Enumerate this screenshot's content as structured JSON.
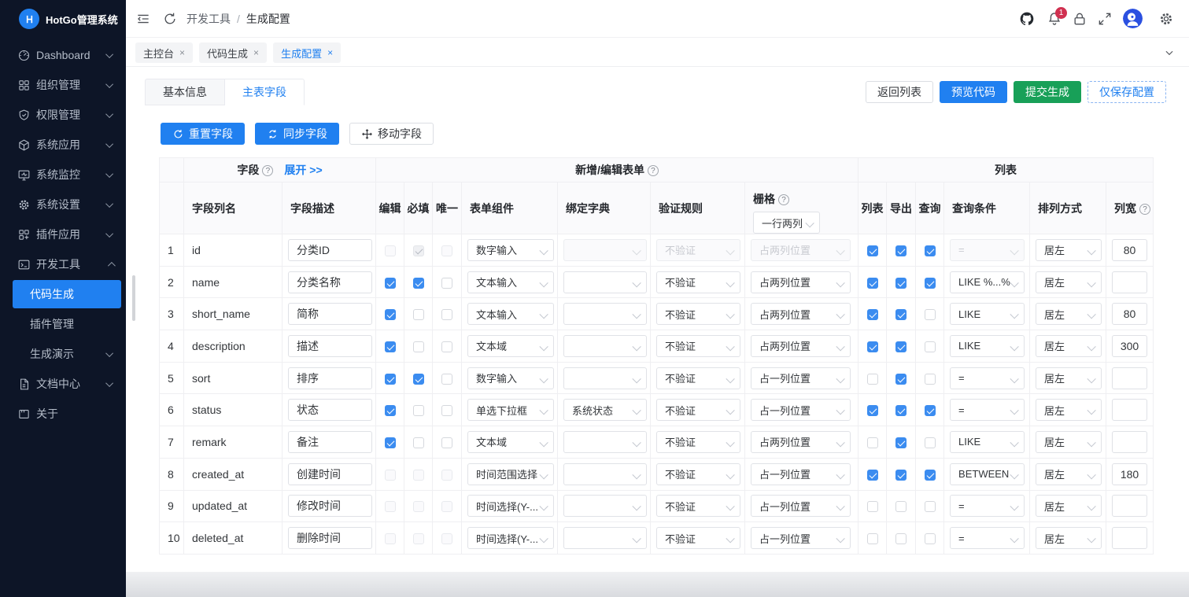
{
  "app": {
    "title": "HotGo管理系统"
  },
  "topbar": {
    "breadcrumb": [
      "开发工具",
      "生成配置"
    ],
    "separator": "/",
    "notification_count": "1"
  },
  "nav_tabs": [
    {
      "label": "主控台",
      "close": "×"
    },
    {
      "label": "代码生成",
      "close": "×"
    },
    {
      "label": "生成配置",
      "close": "×",
      "active": true
    }
  ],
  "page_tabs": [
    {
      "label": "基本信息"
    },
    {
      "label": "主表字段",
      "active": true
    }
  ],
  "header_buttons": [
    {
      "label": "返回列表",
      "variant": "default"
    },
    {
      "label": "预览代码",
      "variant": "primary"
    },
    {
      "label": "提交生成",
      "variant": "success"
    },
    {
      "label": "仅保存配置",
      "variant": "dashed"
    }
  ],
  "action_buttons": [
    {
      "label": "重置字段",
      "variant": "primary",
      "icon": "reset"
    },
    {
      "label": "同步字段",
      "variant": "primary",
      "icon": "sync"
    },
    {
      "label": "移动字段",
      "variant": "default",
      "icon": "move"
    }
  ],
  "table": {
    "groups": {
      "field": "字段",
      "form": "新增/编辑表单",
      "list": "列表"
    },
    "expand_link": "展开 >>",
    "columns": [
      "字段列名",
      "字段描述",
      "编辑",
      "必填",
      "唯一",
      "表单组件",
      "绑定字典",
      "验证规则",
      "栅格",
      "列表",
      "导出",
      "查询",
      "查询条件",
      "排列方式",
      "列宽"
    ],
    "grid_header_select": "一行两列",
    "rows": [
      {
        "idx": "1",
        "col": "id",
        "desc": "分类ID",
        "edit": "dis-off",
        "req": "dis-on",
        "uniq": "dis-off",
        "widget": "数字输入",
        "dict": "",
        "rule": "不验证",
        "grid": "占两列位置",
        "dis": true,
        "list": "on",
        "exp": "on",
        "qry": "on",
        "cond": "=",
        "align": "居左",
        "width": "80"
      },
      {
        "idx": "2",
        "col": "name",
        "desc": "分类名称",
        "edit": "on",
        "req": "on",
        "uniq": "off",
        "widget": "文本输入",
        "dict": "",
        "rule": "不验证",
        "grid": "占两列位置",
        "dis": false,
        "list": "on",
        "exp": "on",
        "qry": "on",
        "cond": "LIKE %...%",
        "align": "居左",
        "width": ""
      },
      {
        "idx": "3",
        "col": "short_name",
        "desc": "简称",
        "edit": "on",
        "req": "off",
        "uniq": "off",
        "widget": "文本输入",
        "dict": "",
        "rule": "不验证",
        "grid": "占两列位置",
        "dis": false,
        "list": "on",
        "exp": "on",
        "qry": "off",
        "cond": "LIKE",
        "align": "居左",
        "width": "80"
      },
      {
        "idx": "4",
        "col": "description",
        "desc": "描述",
        "edit": "on",
        "req": "off",
        "uniq": "off",
        "widget": "文本域",
        "dict": "",
        "rule": "不验证",
        "grid": "占两列位置",
        "dis": false,
        "list": "on",
        "exp": "on",
        "qry": "off",
        "cond": "LIKE",
        "align": "居左",
        "width": "300"
      },
      {
        "idx": "5",
        "col": "sort",
        "desc": "排序",
        "edit": "on",
        "req": "on",
        "uniq": "off",
        "widget": "数字输入",
        "dict": "",
        "rule": "不验证",
        "grid": "占一列位置",
        "dis": false,
        "list": "off",
        "exp": "on",
        "qry": "off",
        "cond": "=",
        "align": "居左",
        "width": ""
      },
      {
        "idx": "6",
        "col": "status",
        "desc": "状态",
        "edit": "on",
        "req": "off",
        "uniq": "off",
        "widget": "单选下拉框",
        "dict": "系统状态",
        "rule": "不验证",
        "grid": "占一列位置",
        "dis": false,
        "list": "on",
        "exp": "on",
        "qry": "on",
        "cond": "=",
        "align": "居左",
        "width": ""
      },
      {
        "idx": "7",
        "col": "remark",
        "desc": "备注",
        "edit": "on",
        "req": "off",
        "uniq": "off",
        "widget": "文本域",
        "dict": "",
        "rule": "不验证",
        "grid": "占两列位置",
        "dis": false,
        "list": "off",
        "exp": "on",
        "qry": "off",
        "cond": "LIKE",
        "align": "居左",
        "width": ""
      },
      {
        "idx": "8",
        "col": "created_at",
        "desc": "创建时间",
        "edit": "dis-off",
        "req": "dis-off",
        "uniq": "dis-off",
        "widget": "时间范围选择",
        "dict": "",
        "rule": "不验证",
        "grid": "占一列位置",
        "dis": false,
        "list": "on",
        "exp": "on",
        "qry": "on",
        "cond": "BETWEEN",
        "align": "居左",
        "width": "180"
      },
      {
        "idx": "9",
        "col": "updated_at",
        "desc": "修改时间",
        "edit": "dis-off",
        "req": "dis-off",
        "uniq": "dis-off",
        "widget": "时间选择(Y-...",
        "dict": "",
        "rule": "不验证",
        "grid": "占一列位置",
        "dis": false,
        "list": "off",
        "exp": "off",
        "qry": "off",
        "cond": "=",
        "align": "居左",
        "width": ""
      },
      {
        "idx": "10",
        "col": "deleted_at",
        "desc": "删除时间",
        "edit": "dis-off",
        "req": "dis-off",
        "uniq": "dis-off",
        "widget": "时间选择(Y-...",
        "dict": "",
        "rule": "不验证",
        "grid": "占一列位置",
        "dis": false,
        "list": "off",
        "exp": "off",
        "qry": "off",
        "cond": "=",
        "align": "居左",
        "width": ""
      }
    ]
  },
  "sidebar": {
    "items": [
      {
        "icon": "dashboard",
        "label": "Dashboard",
        "chev": "down"
      },
      {
        "icon": "org",
        "label": "组织管理",
        "chev": "down"
      },
      {
        "icon": "perm",
        "label": "权限管理",
        "chev": "down"
      },
      {
        "icon": "app",
        "label": "系统应用",
        "chev": "down"
      },
      {
        "icon": "monitor",
        "label": "系统监控",
        "chev": "down"
      },
      {
        "icon": "gear",
        "label": "系统设置",
        "chev": "down"
      },
      {
        "icon": "plugin",
        "label": "插件应用",
        "chev": "down"
      },
      {
        "icon": "devtools",
        "label": "开发工具",
        "chev": "up"
      },
      {
        "label": "代码生成",
        "sub": true,
        "active": true
      },
      {
        "label": "插件管理",
        "sub": true
      },
      {
        "label": "生成演示",
        "sub": true,
        "chev": "down"
      },
      {
        "icon": "docs",
        "label": "文档中心",
        "chev": "down"
      },
      {
        "icon": "about",
        "label": "关于"
      }
    ]
  }
}
